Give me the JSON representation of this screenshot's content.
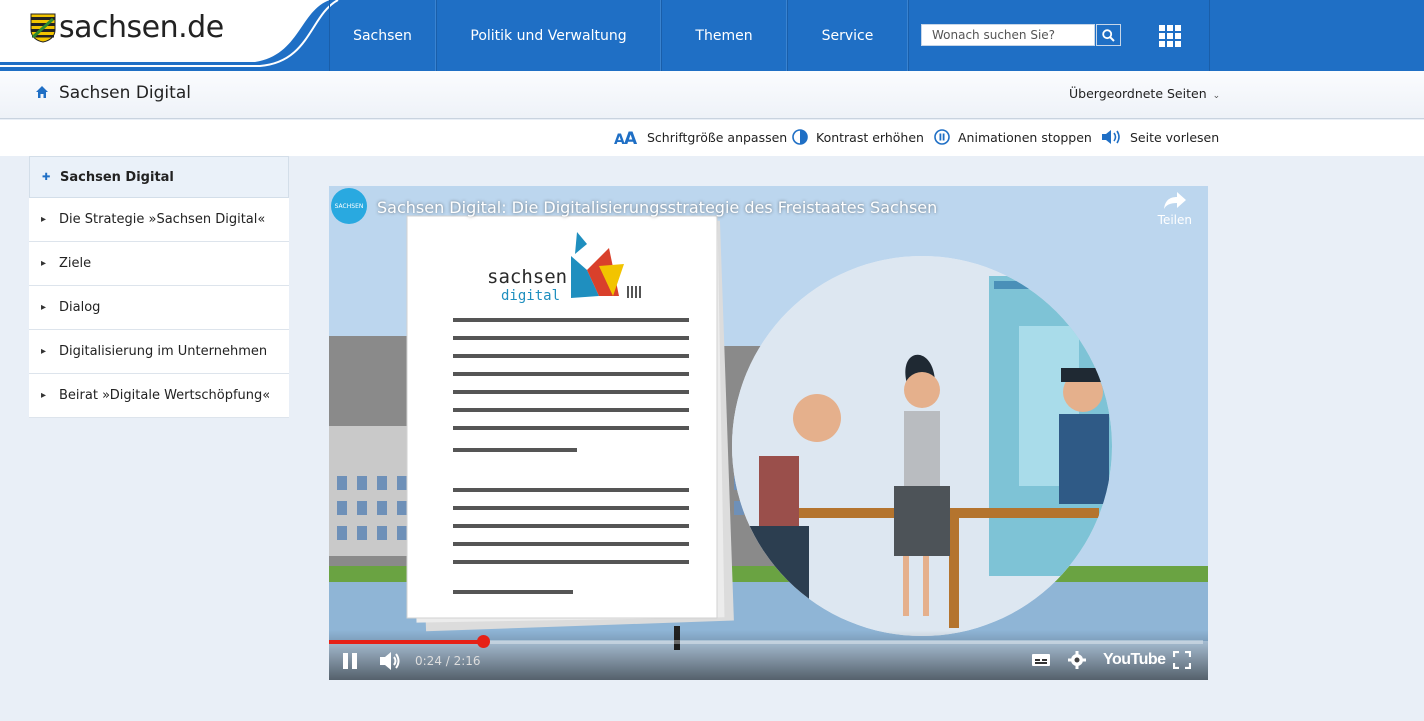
{
  "logo": {
    "text": "sachsen.de"
  },
  "nav": {
    "items": [
      {
        "label": "Sachsen"
      },
      {
        "label": "Politik und Verwaltung"
      },
      {
        "label": "Themen"
      },
      {
        "label": "Service"
      }
    ],
    "search_placeholder": "Wonach suchen Sie?"
  },
  "breadcrumb": {
    "title": "Sachsen Digital",
    "parent_pages": "Übergeordnete Seiten"
  },
  "accessibility": {
    "font_size": "Schriftgröße anpassen",
    "contrast": "Kontrast erhöhen",
    "animations": "Animationen stoppen",
    "read_aloud": "Seite vorlesen"
  },
  "sidebar": {
    "items": [
      {
        "label": "Sachsen Digital"
      },
      {
        "label": "Die Strategie »Sachsen Digital«"
      },
      {
        "label": "Ziele"
      },
      {
        "label": "Dialog"
      },
      {
        "label": "Digitalisierung im Unternehmen"
      },
      {
        "label": "Beirat »Digitale Wertschöpfung«"
      }
    ]
  },
  "video": {
    "title": "Sachsen Digital: Die Digitalisierungsstrategie des Freistaates Sachsen",
    "channel_badge": "SACHSEN",
    "share_label": "Teilen",
    "time": "0:24 / 2:16",
    "progress": 0.176,
    "brand": "YouTube",
    "doc_brand_line1": "sachsen",
    "doc_brand_line2": "digital"
  },
  "colors": {
    "brand_blue": "#1f6fc5",
    "progress_red": "#e62117"
  }
}
